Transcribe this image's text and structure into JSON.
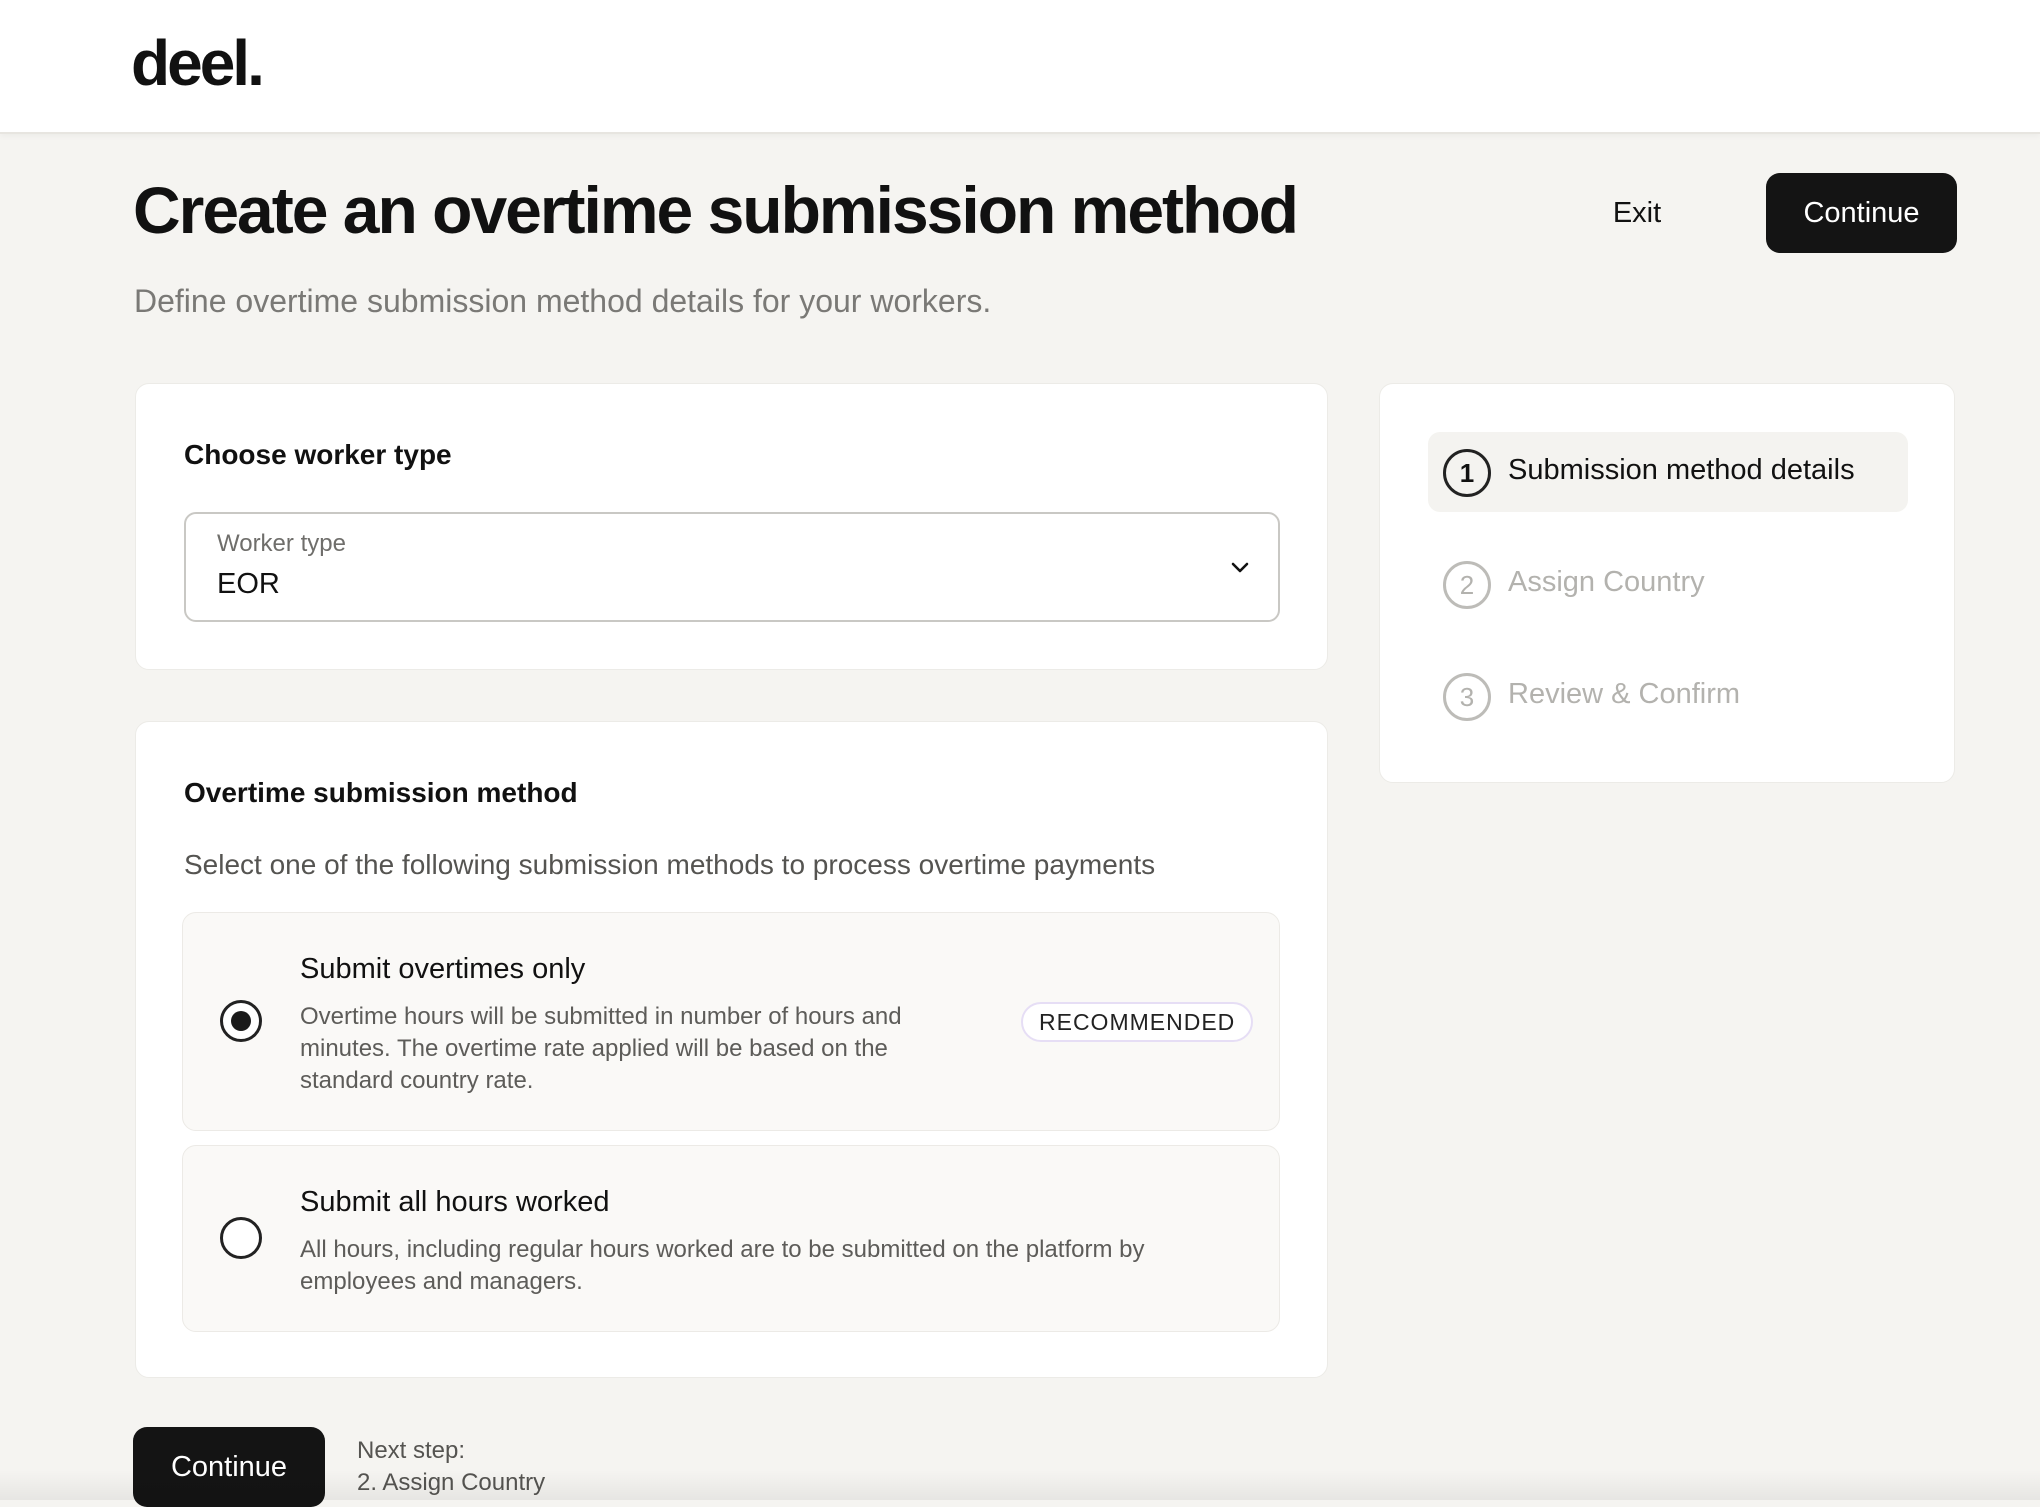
{
  "brand": {
    "logo_text": "deel."
  },
  "header": {
    "title": "Create an overtime submission method",
    "subtitle": "Define overtime submission method details for your workers.",
    "exit_label": "Exit",
    "continue_label": "Continue"
  },
  "worker_card": {
    "heading": "Choose worker type",
    "select_label": "Worker type",
    "select_value": "EOR",
    "select_icon": "chevron-down-icon"
  },
  "method_card": {
    "heading": "Overtime submission method",
    "description": "Select one of the following submission methods to process overtime payments",
    "options": [
      {
        "title": "Submit overtimes only",
        "text_lines": [
          "Overtime hours will be submitted in number of hours and",
          "minutes. The overtime rate applied will be based on the",
          "standard country rate."
        ],
        "badge": "RECOMMENDED",
        "selected": true
      },
      {
        "title": "Submit all hours worked",
        "text_lines": [
          "All hours, including regular hours worked are to be submitted on the platform by",
          "employees and managers."
        ],
        "selected": false
      }
    ]
  },
  "steps": [
    {
      "number": "1",
      "label": "Submission method details",
      "active": true
    },
    {
      "number": "2",
      "label": "Assign Country",
      "active": false
    },
    {
      "number": "3",
      "label": "Review & Confirm",
      "active": false
    }
  ],
  "footer": {
    "continue_label": "Continue",
    "next_step_label": "Next step:",
    "next_step_value": "2. Assign Country"
  }
}
